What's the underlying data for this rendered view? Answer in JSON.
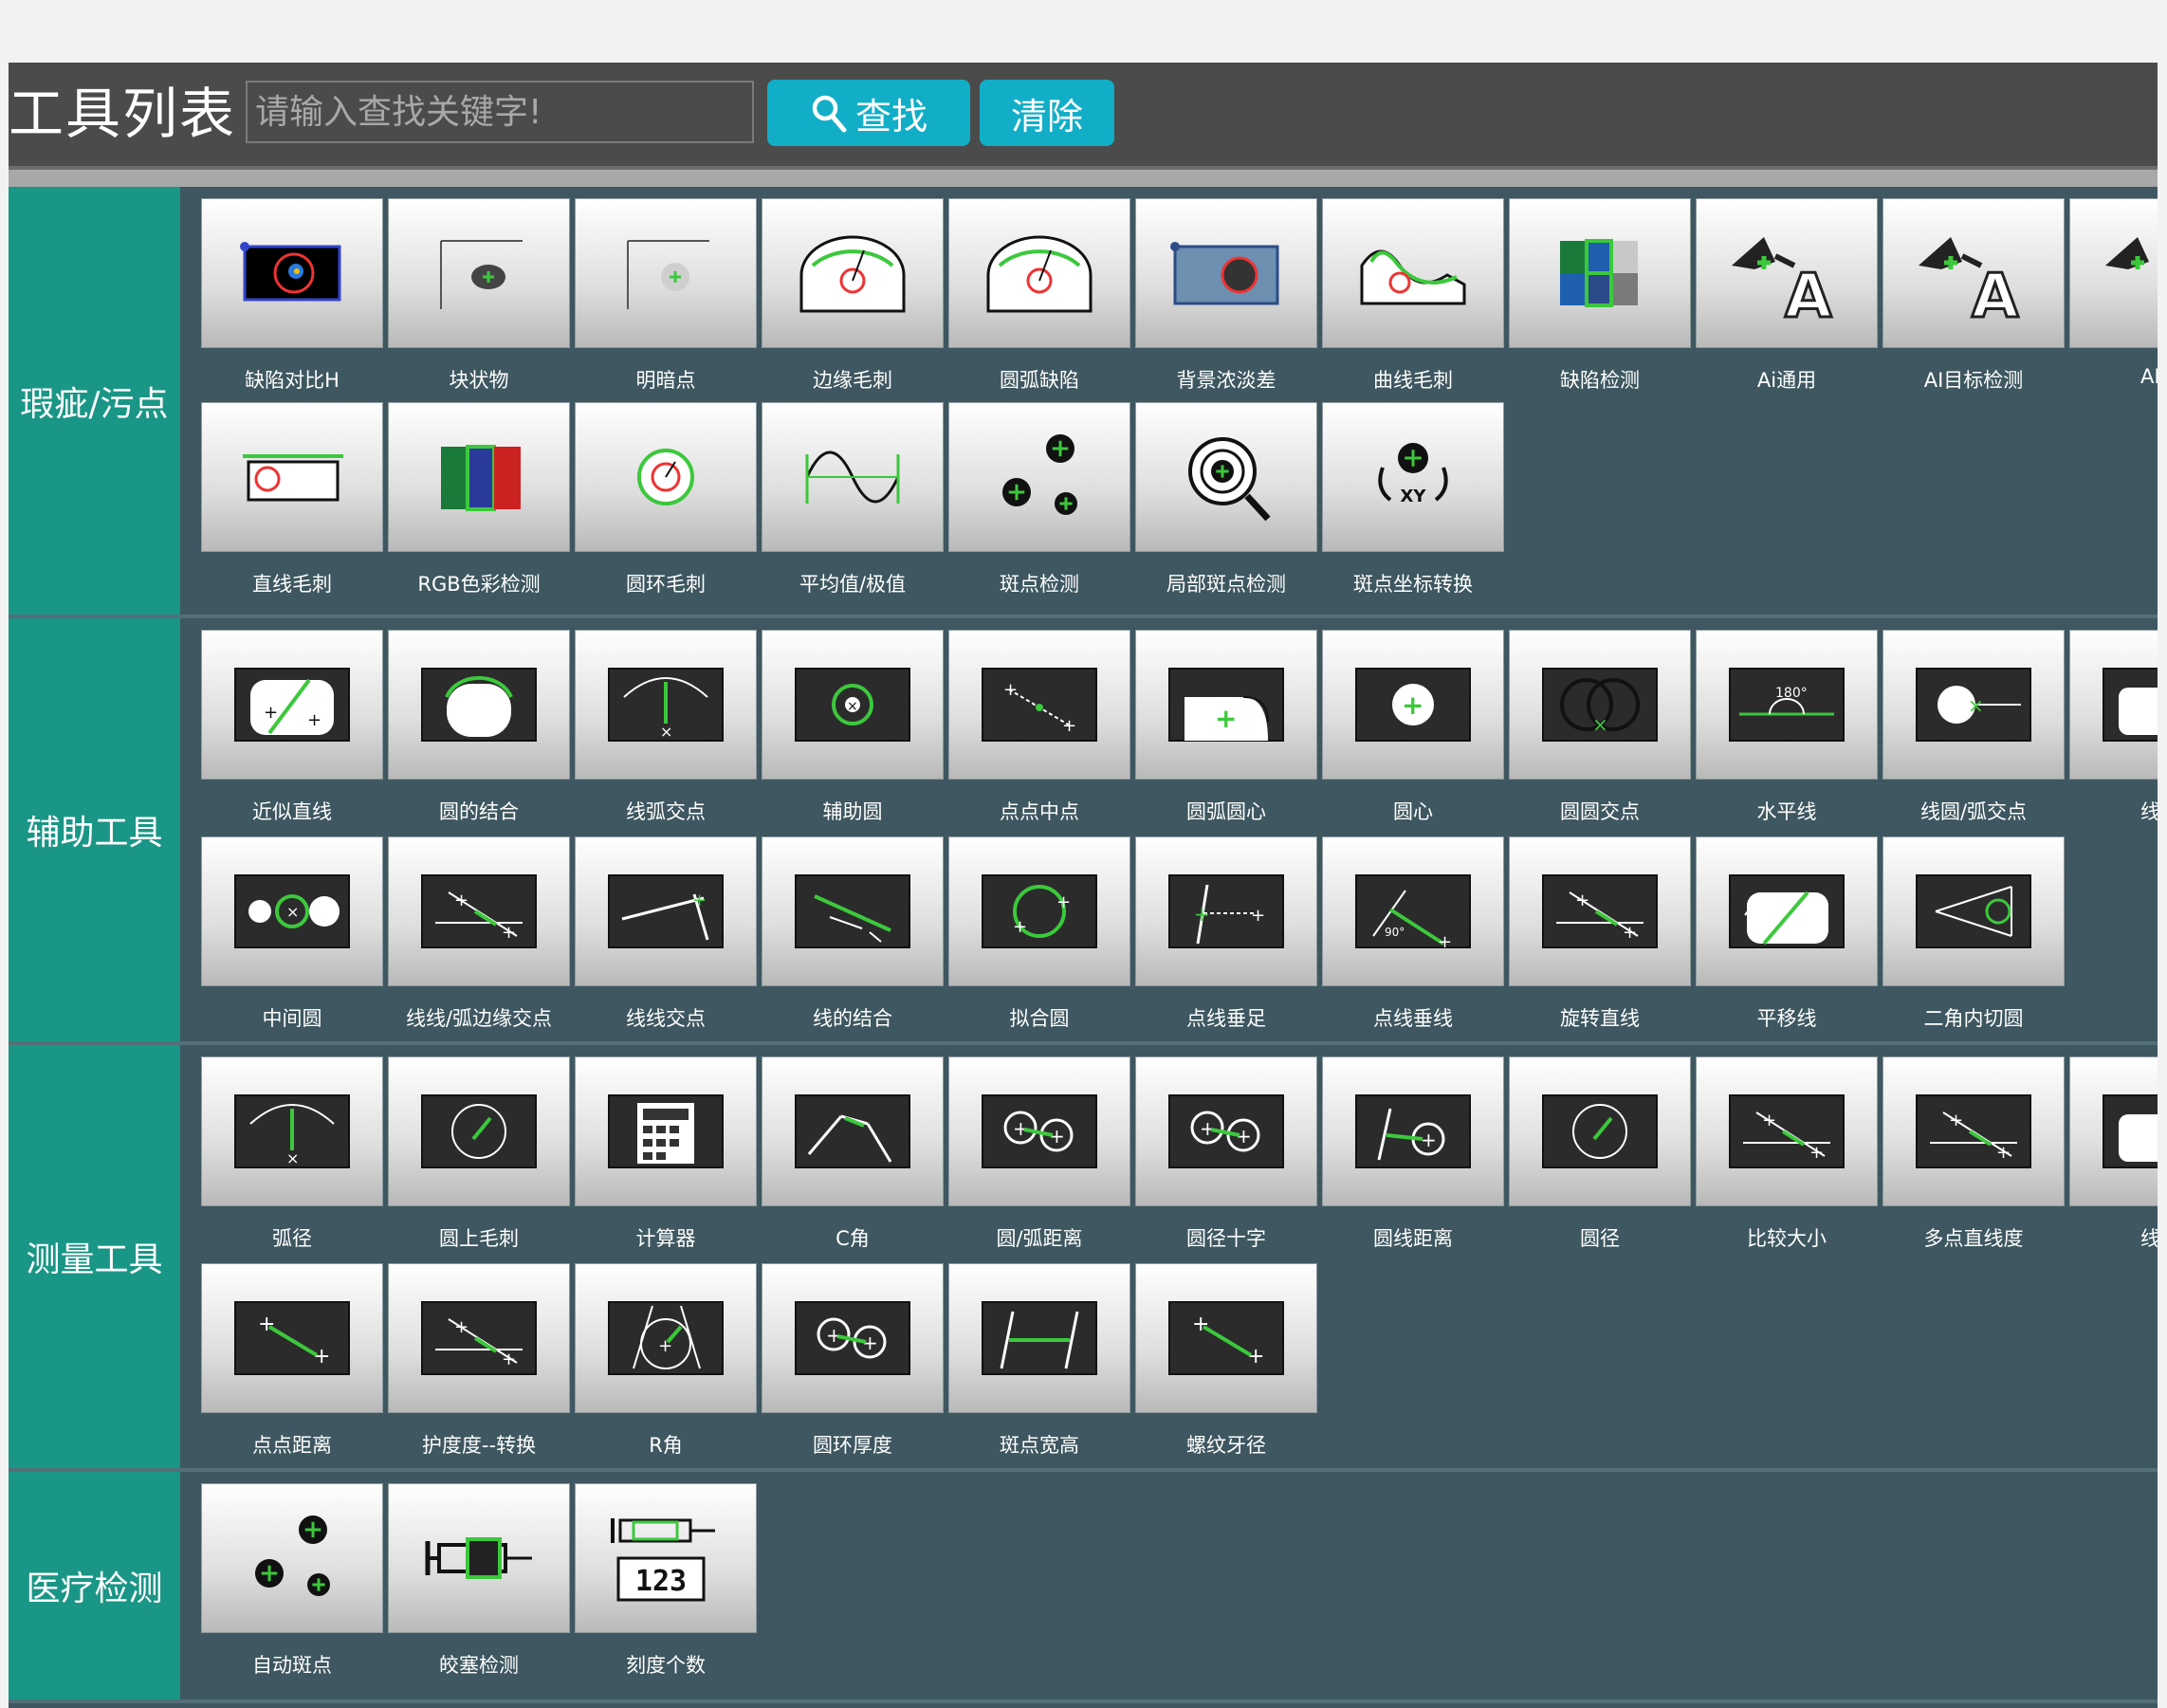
{
  "header": {
    "title": "工具列表",
    "search_placeholder": "请输入查找关键字!",
    "search_label": "查找",
    "clear_label": "清除"
  },
  "colors": {
    "accent": "#12aec8",
    "sidebar": "#1a9686",
    "panel": "#3e5760",
    "header": "#4b4b4b",
    "highlight": "#3cc83c"
  },
  "sections": [
    {
      "id": "defect",
      "label": "瑕疵/污点",
      "rows": [
        [
          {
            "label": "缺陷对比H",
            "icon": "defect-compare-icon"
          },
          {
            "label": "块状物",
            "icon": "blob-icon"
          },
          {
            "label": "明暗点",
            "icon": "bright-dark-spot-icon"
          },
          {
            "label": "边缘毛刺",
            "icon": "edge-burr-icon"
          },
          {
            "label": "圆弧缺陷",
            "icon": "arc-defect-icon"
          },
          {
            "label": "背景浓淡差",
            "icon": "background-contrast-icon"
          },
          {
            "label": "曲线毛刺",
            "icon": "curve-burr-icon"
          },
          {
            "label": "缺陷检测",
            "icon": "defect-detect-icon"
          },
          {
            "label": "Ai通用",
            "icon": "ai-general-icon"
          },
          {
            "label": "AI目标检测",
            "icon": "ai-target-icon"
          },
          {
            "label": "AI C",
            "icon": "ai-more-icon"
          }
        ],
        [
          {
            "label": "直线毛刺",
            "icon": "line-burr-icon"
          },
          {
            "label": "RGB色彩检测",
            "icon": "rgb-color-icon"
          },
          {
            "label": "圆环毛刺",
            "icon": "ring-burr-icon"
          },
          {
            "label": "平均值/极值",
            "icon": "average-wave-icon"
          },
          {
            "label": "斑点检测",
            "icon": "spot-detect-icon"
          },
          {
            "label": "局部斑点检测",
            "icon": "local-spot-icon"
          },
          {
            "label": "斑点坐标转换",
            "icon": "spot-coord-icon"
          }
        ]
      ]
    },
    {
      "id": "aux",
      "label": "辅助工具",
      "rows": [
        [
          {
            "label": "近似直线",
            "icon": "approx-line-icon"
          },
          {
            "label": "圆的结合",
            "icon": "circle-combine-icon"
          },
          {
            "label": "线弧交点",
            "icon": "line-arc-intersect-icon"
          },
          {
            "label": "辅助圆",
            "icon": "aux-circle-icon"
          },
          {
            "label": "点点中点",
            "icon": "midpoint-icon"
          },
          {
            "label": "圆弧圆心",
            "icon": "arc-center-icon"
          },
          {
            "label": "圆心",
            "icon": "circle-center-icon"
          },
          {
            "label": "圆圆交点",
            "icon": "circle-intersect-icon"
          },
          {
            "label": "水平线",
            "icon": "horizontal-line-icon"
          },
          {
            "label": "线圆/弧交点",
            "icon": "line-circle-intersect-icon"
          },
          {
            "label": "线线",
            "icon": "line-more-icon"
          }
        ],
        [
          {
            "label": "中间圆",
            "icon": "middle-circle-icon"
          },
          {
            "label": "线线/弧边缘交点",
            "icon": "line-edge-intersect-icon"
          },
          {
            "label": "线线交点",
            "icon": "line-line-intersect-icon"
          },
          {
            "label": "线的结合",
            "icon": "line-combine-icon"
          },
          {
            "label": "拟合圆",
            "icon": "fit-circle-icon"
          },
          {
            "label": "点线垂足",
            "icon": "perpendicular-foot-icon"
          },
          {
            "label": "点线垂线",
            "icon": "perpendicular-line-icon"
          },
          {
            "label": "旋转直线",
            "icon": "rotate-line-icon"
          },
          {
            "label": "平移线",
            "icon": "shift-line-icon"
          },
          {
            "label": "二角内切圆",
            "icon": "incircle-icon"
          }
        ]
      ]
    },
    {
      "id": "measure",
      "label": "测量工具",
      "rows": [
        [
          {
            "label": "弧径",
            "icon": "arc-radius-icon"
          },
          {
            "label": "圆上毛刺",
            "icon": "circle-burr-icon"
          },
          {
            "label": "计算器",
            "icon": "calculator-icon"
          },
          {
            "label": "C角",
            "icon": "chamfer-icon"
          },
          {
            "label": "圆/弧距离",
            "icon": "circle-distance-icon"
          },
          {
            "label": "圆径十字",
            "icon": "circle-cross-icon"
          },
          {
            "label": "圆线距离",
            "icon": "circle-line-distance-icon"
          },
          {
            "label": "圆径",
            "icon": "circle-diameter-icon"
          },
          {
            "label": "比较大小",
            "icon": "compare-size-icon"
          },
          {
            "label": "多点直线度",
            "icon": "straightness-icon"
          },
          {
            "label": "线线",
            "icon": "line-more-icon"
          }
        ],
        [
          {
            "label": "点点距离",
            "icon": "point-distance-icon"
          },
          {
            "label": "护度度--转换",
            "icon": "angle-convert-icon"
          },
          {
            "label": "R角",
            "icon": "r-angle-icon"
          },
          {
            "label": "圆环厚度",
            "icon": "ring-thickness-icon"
          },
          {
            "label": "斑点宽高",
            "icon": "spot-size-icon"
          },
          {
            "label": "螺纹牙径",
            "icon": "thread-pitch-icon"
          }
        ]
      ]
    },
    {
      "id": "medical",
      "label": "医疗检测",
      "rows": [
        [
          {
            "label": "自动斑点",
            "icon": "auto-spot-icon"
          },
          {
            "label": "皎塞检测",
            "icon": "syringe-plug-icon"
          },
          {
            "label": "刻度个数",
            "icon": "scale-count-icon"
          }
        ]
      ]
    }
  ]
}
